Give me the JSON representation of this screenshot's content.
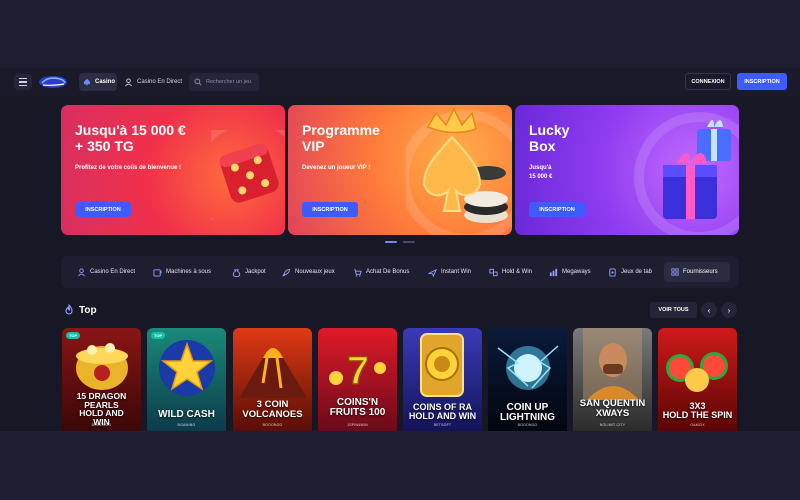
{
  "header": {
    "menu_icon": "hamburger-menu-icon",
    "logo_icon": "brand-logo",
    "nav": [
      {
        "label": "Casino",
        "icon": "spade-icon"
      },
      {
        "label": "Casino En Direct",
        "icon": "dealer-icon"
      }
    ],
    "search_placeholder": "Rechercher un jeu",
    "login_label": "CONNEXION",
    "signup_label": "INSCRIPTION"
  },
  "banners": [
    {
      "title": "Jusqu'à 15 000 €\n+ 350 TG",
      "subtitle": "Profitez de votre colis de bienvenue !",
      "cta": "INSCRIPTION"
    },
    {
      "title": "Programme\nVIP",
      "subtitle": "Devenez un joueur VIP !",
      "cta": "INSCRIPTION"
    },
    {
      "title": "Lucky\nBox",
      "subtitle": "Jusqu'à\n15 000 €",
      "cta": "INSCRIPTION"
    }
  ],
  "carousel": {
    "count": 2,
    "active": 0
  },
  "categories": [
    {
      "label": "Casino En Direct",
      "icon": "dealer-icon"
    },
    {
      "label": "Machines à sous",
      "icon": "slot-machine-icon"
    },
    {
      "label": "Jackpot",
      "icon": "money-bag-icon"
    },
    {
      "label": "Nouveaux jeux",
      "icon": "rocket-icon"
    },
    {
      "label": "Achat De Bonus",
      "icon": "cart-icon"
    },
    {
      "label": "Instant Win",
      "icon": "plane-icon"
    },
    {
      "label": "Hold & Win",
      "icon": "hold-win-icon"
    },
    {
      "label": "Megaways",
      "icon": "megaways-icon"
    },
    {
      "label": "Jeux de tab",
      "icon": "table-games-icon"
    },
    {
      "label": "Fournisseurs",
      "icon": "grid-icon"
    }
  ],
  "section": {
    "title": "Top",
    "icon": "flame-icon",
    "view_all": "VOIR TOUS",
    "prev_icon": "chevron-left-icon",
    "next_icon": "chevron-right-icon"
  },
  "games": [
    {
      "title": "15 DRAGON PEARLS\nHOLD AND\nWIN",
      "provider": "BOOONGO",
      "badge": "TOP",
      "colors": [
        "#8a1515",
        "#3a0707"
      ]
    },
    {
      "title": "WILD CASH",
      "provider": "BGAMING",
      "badge": "TOP",
      "colors": [
        "#1a8a7a",
        "#0b3b4a"
      ]
    },
    {
      "title": "3 COIN\nVOLCANOES",
      "provider": "BOOONGO",
      "badge": "",
      "colors": [
        "#e03a14",
        "#5a0e08"
      ]
    },
    {
      "title": "COINS'N\nFRUITS 100",
      "provider": "1SPIN4WIN",
      "badge": "",
      "colors": [
        "#e01a2a",
        "#6a0a1a"
      ]
    },
    {
      "title": "COINS OF RA\nHOLD AND WIN",
      "provider": "BETSOFT",
      "badge": "",
      "colors": [
        "#3a3ab8",
        "#14145a"
      ]
    },
    {
      "title": "COIN UP\nLIGHTNING",
      "provider": "BOOONGO",
      "badge": "",
      "colors": [
        "#0a1a3a",
        "#02060f"
      ]
    },
    {
      "title": "SAN QUENTIN\nXWAYS",
      "provider": "NOLIMIT CITY",
      "badge": "",
      "colors": [
        "#7a7a7a",
        "#2b2b2b"
      ]
    },
    {
      "title": "3X3\nHOLD THE SPIN",
      "provider": "GAMZIX",
      "badge": "",
      "colors": [
        "#d01a1a",
        "#5a0505"
      ]
    }
  ],
  "colors": {
    "accent": "#3d5bff",
    "bg": "#1f1f31",
    "panel": "#171725"
  }
}
